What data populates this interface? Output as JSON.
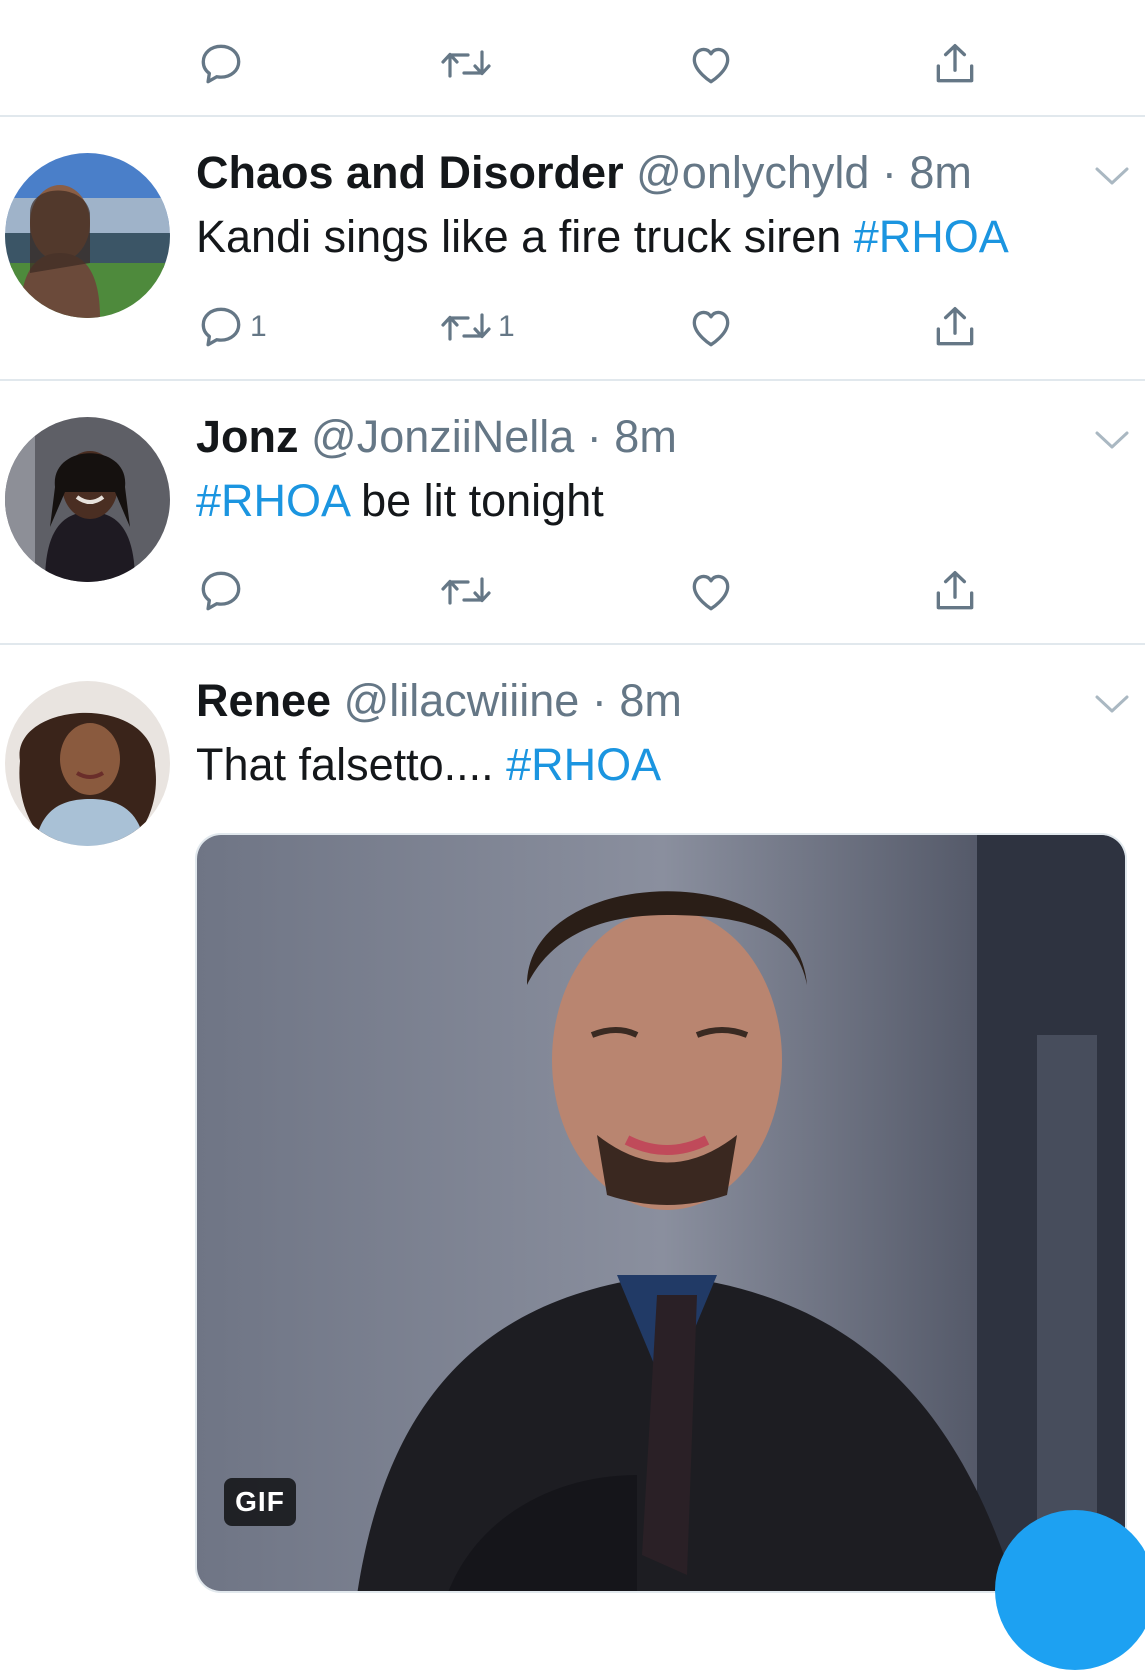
{
  "colors": {
    "accent": "#1da1f2",
    "hashtag": "#1b95e0",
    "secondary_text": "#657786",
    "divider": "#e1e8ed"
  },
  "top_action_bar": {
    "reply_icon": "reply-icon",
    "retweet_icon": "retweet-icon",
    "like_icon": "like-icon",
    "share_icon": "share-icon"
  },
  "tweets": [
    {
      "name": "Chaos and Disorder",
      "meta": "@onlychyld · 8m",
      "text": "Kandi sings like a fire truck siren ",
      "hashtag": "#RHOA",
      "reply_count": "1",
      "retweet_count": "1"
    },
    {
      "name": "Jonz",
      "meta": "@JonziiNella · 8m",
      "hashtag": "#RHOA",
      "text": " be lit tonight"
    },
    {
      "name": "Renee",
      "meta": "@lilacwiiine · 8m",
      "text": "That falsetto.... ",
      "hashtag": "#RHOA",
      "media_badge": "GIF"
    }
  ]
}
